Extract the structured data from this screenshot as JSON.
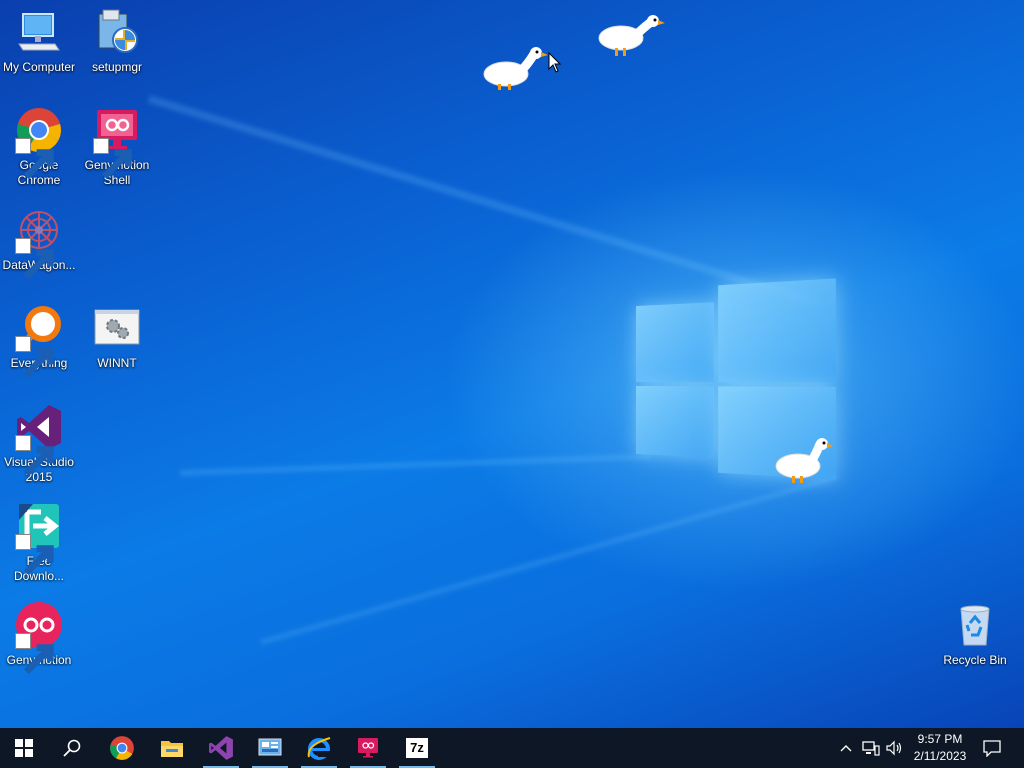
{
  "desktop": {
    "icons": [
      {
        "label": "My Computer",
        "icon": "computer-icon"
      },
      {
        "label": "setupmgr",
        "icon": "setup-manager-icon"
      },
      {
        "label": "Google Chrome",
        "icon": "chrome-icon"
      },
      {
        "label": "Genymotion Shell",
        "icon": "genymotion-shell-icon"
      },
      {
        "label": "DataWagon...",
        "icon": "datawagon-icon"
      },
      {
        "label": "Everything",
        "icon": "everything-search-icon"
      },
      {
        "label": "WINNT",
        "icon": "winnt-icon"
      },
      {
        "label": "Visual Studio 2015",
        "icon": "visual-studio-icon"
      },
      {
        "label": "Free Downlo...",
        "icon": "free-download-manager-icon"
      },
      {
        "label": "Genymotion",
        "icon": "genymotion-icon"
      },
      {
        "label": "Recycle Bin",
        "icon": "recycle-bin-icon"
      }
    ]
  },
  "taskbar": {
    "pinned": [
      "start-icon",
      "search-icon",
      "chrome-icon",
      "file-explorer-icon",
      "visual-studio-icon",
      "control-panel-icon",
      "internet-explorer-icon",
      "genymotion-shell-icon",
      "7zip-icon"
    ],
    "sevenzip_label": "7z",
    "clock": {
      "time": "9:57 PM",
      "date": "2/11/2023"
    }
  },
  "colors": {
    "taskbar": "#0d1726",
    "accent": "#76b9ed",
    "wallpaper": "#0b7be6"
  }
}
